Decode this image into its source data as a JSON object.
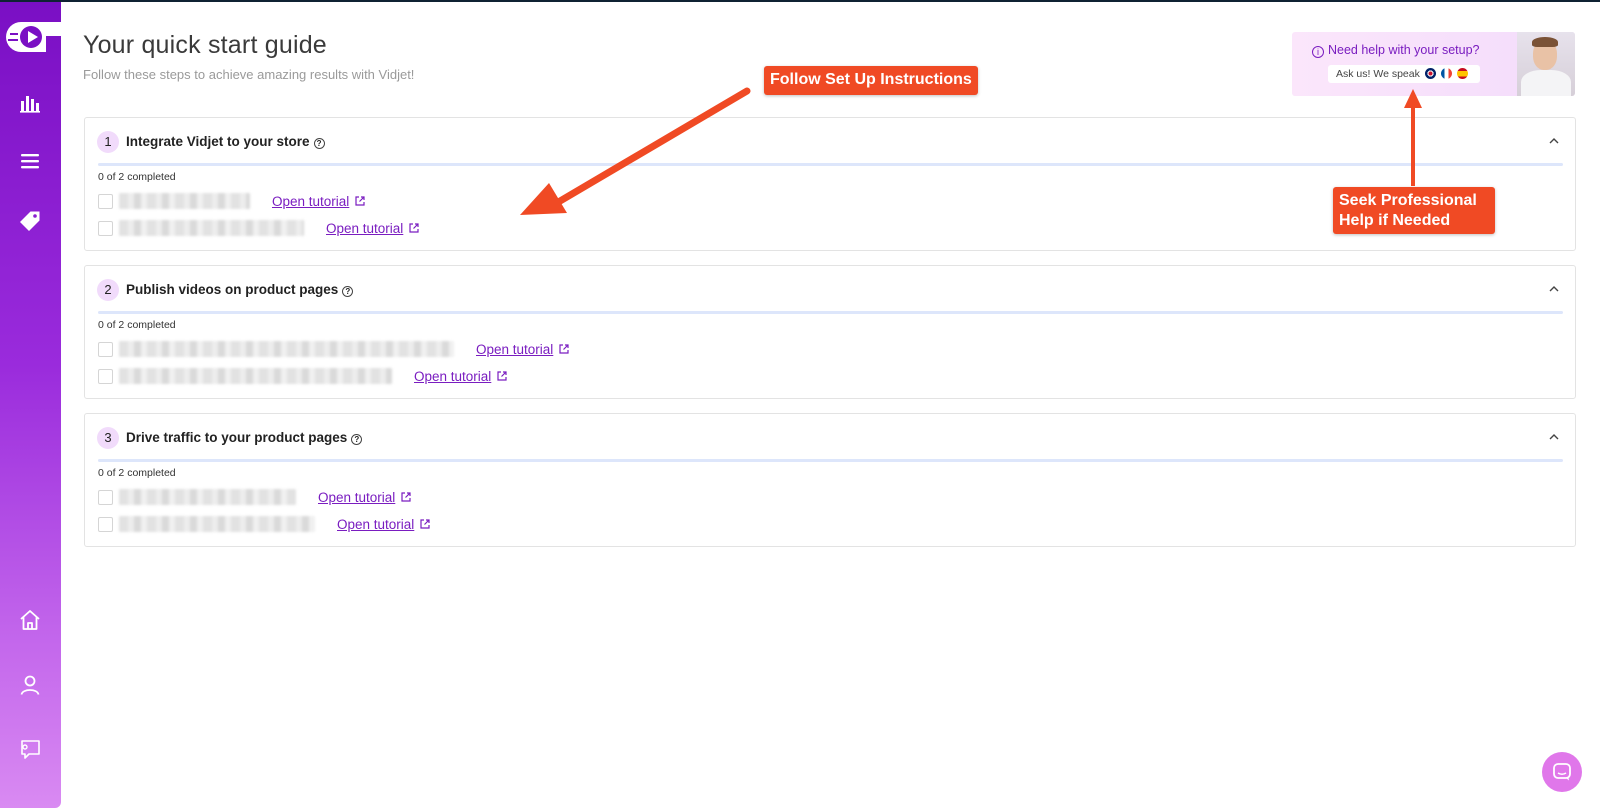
{
  "page": {
    "title": "Your quick start guide",
    "subtitle": "Follow these steps to achieve amazing results with Vidjet!"
  },
  "sidebar": {
    "logo_icon": "vidjet-logo-icon",
    "items": [
      {
        "icon": "analytics-icon"
      },
      {
        "icon": "menu-icon"
      },
      {
        "icon": "tag-icon"
      },
      {
        "icon": "home-icon"
      },
      {
        "icon": "user-icon"
      },
      {
        "icon": "feedback-icon"
      }
    ],
    "gradient": [
      "#7a0fc4",
      "#d98af2"
    ]
  },
  "help": {
    "question": "Need help with your setup?",
    "pill": "Ask us! We speak",
    "languages": [
      "uk-flag-icon",
      "fr-flag-icon",
      "es-flag-icon"
    ]
  },
  "sections": [
    {
      "number": "1",
      "title": "Integrate Vidjet to your store",
      "completed_text": "0 of 2 completed",
      "progress": 0,
      "tasks": [
        {
          "link": "Open tutorial"
        },
        {
          "link": "Open tutorial"
        }
      ]
    },
    {
      "number": "2",
      "title": "Publish videos on product pages",
      "completed_text": "0 of 2 completed",
      "progress": 0,
      "tasks": [
        {
          "link": "Open tutorial"
        },
        {
          "link": "Open tutorial"
        }
      ]
    },
    {
      "number": "3",
      "title": "Drive traffic to your product pages",
      "completed_text": "0 of 2 completed",
      "progress": 0,
      "tasks": [
        {
          "link": "Open tutorial"
        },
        {
          "link": "Open tutorial"
        }
      ]
    }
  ],
  "annotations": {
    "follow": "Follow Set Up Instructions",
    "seek": "Seek Professional Help if Needed",
    "color": "#f04a24"
  },
  "colors": {
    "accent": "#7a1dc0",
    "progress_track": "#dde6fb",
    "number_badge": "#f1dbfb"
  }
}
